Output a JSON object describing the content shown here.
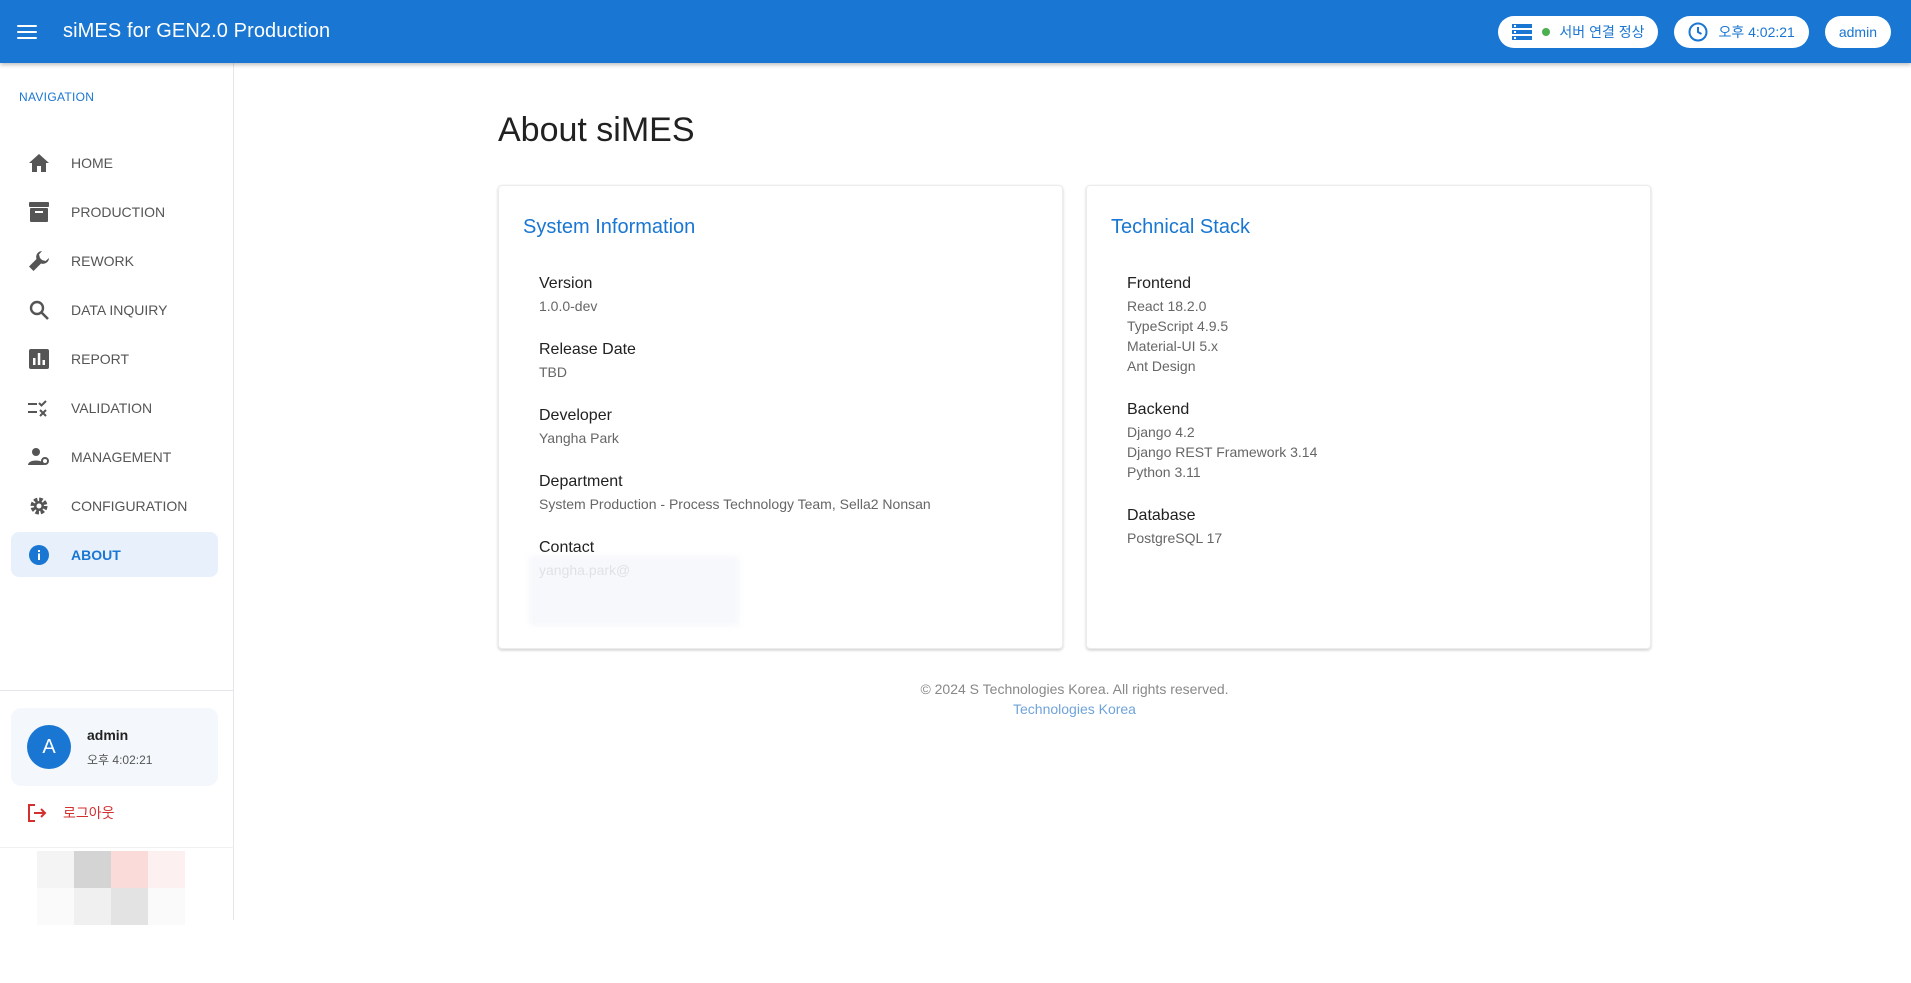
{
  "header": {
    "title": "siMES for GEN2.0 Production",
    "server_status": "서버 연결 정상",
    "clock": "오후 4:02:21",
    "user": "admin",
    "colors": {
      "primary": "#1976d2",
      "status_ok": "#4caf50"
    }
  },
  "sidebar": {
    "section_title": "NAVIGATION",
    "items": [
      {
        "label": "HOME",
        "icon": "home-icon"
      },
      {
        "label": "PRODUCTION",
        "icon": "archive-box-icon"
      },
      {
        "label": "REWORK",
        "icon": "wrench-icon"
      },
      {
        "label": "DATA INQUIRY",
        "icon": "search-icon"
      },
      {
        "label": "REPORT",
        "icon": "bar-chart-icon"
      },
      {
        "label": "VALIDATION",
        "icon": "checklist-icon"
      },
      {
        "label": "MANAGEMENT",
        "icon": "user-gear-icon"
      },
      {
        "label": "CONFIGURATION",
        "icon": "gear-icon"
      },
      {
        "label": "ABOUT",
        "icon": "info-icon",
        "active": true
      }
    ],
    "user_card": {
      "avatar_letter": "A",
      "name": "admin",
      "time": "오후 4:02:21"
    },
    "logout_label": "로그아웃"
  },
  "main": {
    "title": "About siMES",
    "system_info": {
      "title": "System Information",
      "items": [
        {
          "label": "Version",
          "value": "1.0.0-dev"
        },
        {
          "label": "Release Date",
          "value": "TBD"
        },
        {
          "label": "Developer",
          "value": "Yangha Park"
        },
        {
          "label": "Department",
          "value": "System Production - Process Technology Team, Sella2 Nonsan"
        },
        {
          "label": "Contact",
          "value": "yangha.park@"
        }
      ]
    },
    "tech_stack": {
      "title": "Technical Stack",
      "groups": [
        {
          "label": "Frontend",
          "items": [
            "React 18.2.0",
            "TypeScript 4.9.5",
            "Material-UI 5.x",
            "Ant Design"
          ]
        },
        {
          "label": "Backend",
          "items": [
            "Django 4.2",
            "Django REST Framework 3.14",
            "Python 3.11"
          ]
        },
        {
          "label": "Database",
          "items": [
            "PostgreSQL 17"
          ]
        }
      ]
    },
    "footer": {
      "copyright": "© 2024 S Technologies Korea. All rights reserved.",
      "company": "Technologies Korea"
    }
  }
}
